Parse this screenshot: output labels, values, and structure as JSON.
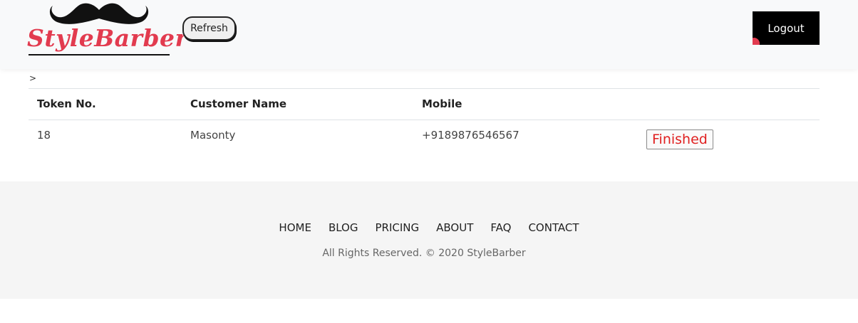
{
  "header": {
    "logo_text": "StyleBarber",
    "refresh_label": "Refresh",
    "logout_label": "Logout"
  },
  "breadcrumb": ">",
  "table": {
    "columns": [
      "Token No.",
      "Customer Name",
      "Mobile",
      ""
    ],
    "rows": [
      {
        "token": "18",
        "customer": "Masonty",
        "mobile": "+9189876546567",
        "status": "Finished"
      }
    ]
  },
  "footer": {
    "nav": [
      "HOME",
      "BLOG",
      "PRICING",
      "ABOUT",
      "FAQ",
      "CONTACT"
    ],
    "copyright": "All Rights Reserved. © 2020 StyleBarber"
  },
  "colors": {
    "brand": "#e23b4f",
    "status_finished": "#e02020",
    "header_bg": "#f8f9fa",
    "footer_bg": "#f5f5f5",
    "logout_bg": "#000000"
  }
}
